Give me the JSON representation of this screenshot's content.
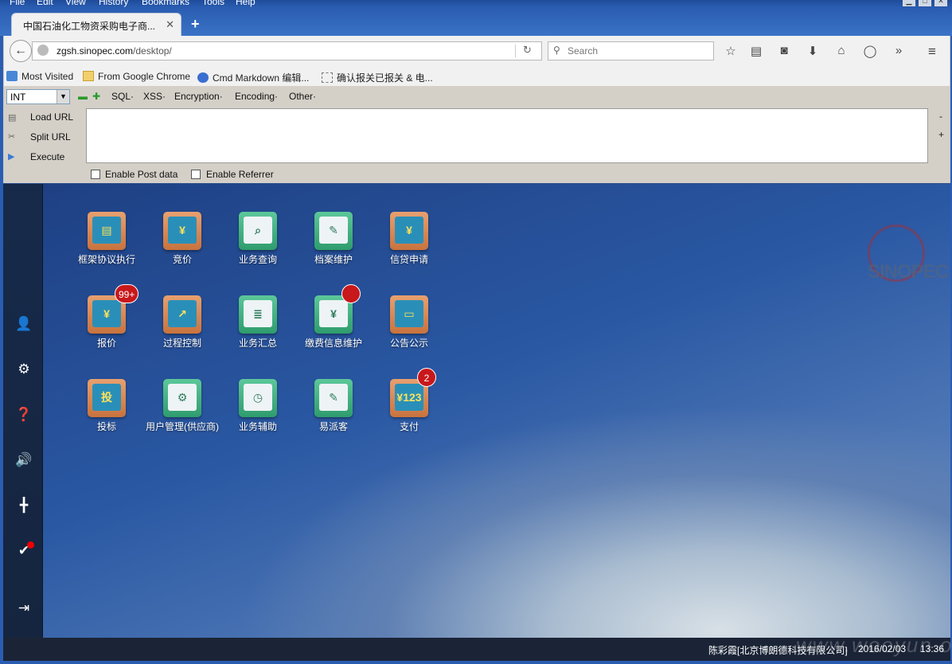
{
  "menubar": {
    "items": [
      "File",
      "Edit",
      "View",
      "History",
      "Bookmarks",
      "Tools",
      "Help"
    ]
  },
  "tab": {
    "title": "中国石油化工物资采购电子商...",
    "close": "✕",
    "new_tab": "+"
  },
  "nav": {
    "url_host": "zgsh.sinopec.com",
    "url_path": "/desktop/",
    "search_placeholder": "Search"
  },
  "bookmarks": [
    "Most Visited",
    "From Google Chrome",
    "Cmd Markdown 编辑...",
    "确认报关已报关 & 电..."
  ],
  "hackbar": {
    "select_value": "INT",
    "menus": [
      "SQL·",
      "XSS·",
      "Encryption·",
      "Encoding·",
      "Other·"
    ],
    "side": [
      "Load URL",
      "Split URL",
      "Execute"
    ],
    "checks": [
      "Enable Post data",
      "Enable Referrer"
    ],
    "plus_minus": [
      "-",
      "+"
    ]
  },
  "apps": [
    {
      "label": "框架协议执行",
      "style": "orange",
      "glyph": "▤"
    },
    {
      "label": "竞价",
      "style": "orange",
      "glyph": "¥"
    },
    {
      "label": "业务查询",
      "style": "green",
      "glyph": "⌕"
    },
    {
      "label": "档案维护",
      "style": "green",
      "glyph": "✎"
    },
    {
      "label": "信贷申请",
      "style": "orange",
      "glyph": "¥"
    },
    {
      "label": "报价",
      "style": "orange",
      "glyph": "¥",
      "badge": "99+"
    },
    {
      "label": "过程控制",
      "style": "orange",
      "glyph": "↗"
    },
    {
      "label": "业务汇总",
      "style": "green",
      "glyph": "≣"
    },
    {
      "label": "缴费信息维护",
      "style": "green",
      "glyph": "¥",
      "badge_dot": true
    },
    {
      "label": "公告公示",
      "style": "orange",
      "glyph": "▭"
    },
    {
      "label": "投标",
      "style": "orange",
      "glyph": "投"
    },
    {
      "label": "用户管理(供应商)",
      "style": "green",
      "glyph": "⚙"
    },
    {
      "label": "业务辅助",
      "style": "green",
      "glyph": "◷"
    },
    {
      "label": "易派客",
      "style": "green",
      "glyph": "✎"
    },
    {
      "label": "支付",
      "style": "orange",
      "glyph": "¥123",
      "badge": "2"
    }
  ],
  "logo": {
    "text": "SINOPEC"
  },
  "status": {
    "user": "陈彩霞[北京博朗德科技有限公司]",
    "date": "2016/02/03",
    "time": "13:36"
  },
  "watermark": "www.wooyun.org",
  "colors": {
    "badge": "#c8181c",
    "sidebar": "#172a4a",
    "statusbar": "#1b2436"
  }
}
